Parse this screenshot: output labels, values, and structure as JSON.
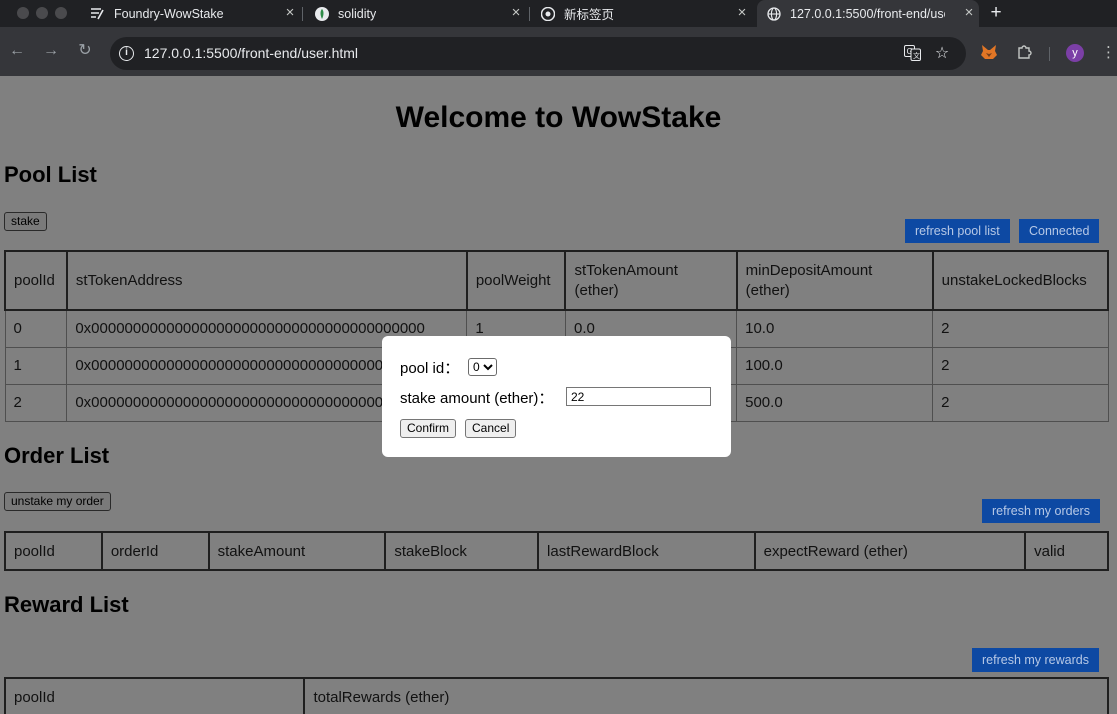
{
  "browser": {
    "tabs": [
      {
        "title": "Foundry-WowStake",
        "icon": "foundry-icon",
        "active": false
      },
      {
        "title": "solidity",
        "icon": "leaf-icon",
        "active": false
      },
      {
        "title": "新标签页",
        "icon": "chrome-icon",
        "active": false
      },
      {
        "title": "127.0.0.1:5500/front-end/user.html",
        "icon": "globe-icon",
        "active": true
      }
    ],
    "url": "127.0.0.1:5500/front-end/user.html",
    "avatar_letter": "y"
  },
  "page": {
    "title": "Welcome to WowStake",
    "pool_section": {
      "heading": "Pool List",
      "stake_button": "stake",
      "refresh_button": "refresh pool list",
      "connect_button": "Connected",
      "headers": [
        "poolId",
        "stTokenAddress",
        "poolWeight",
        "stTokenAmount\n(ether)",
        "minDepositAmount\n(ether)",
        "unstakeLockedBlocks"
      ],
      "rows": [
        [
          "0",
          "0x0000000000000000000000000000000000000000",
          "1",
          "0.0",
          "10.0",
          "2"
        ],
        [
          "1",
          "0x0000000000000000000000000000000000000000",
          "",
          "",
          "100.0",
          "2"
        ],
        [
          "2",
          "0x0000000000000000000000000000000000000000",
          "",
          "",
          "500.0",
          "2"
        ]
      ]
    },
    "order_section": {
      "heading": "Order List",
      "unstake_button": "unstake my order",
      "refresh_button": "refresh my orders",
      "headers": [
        "poolId",
        "orderId",
        "stakeAmount",
        "stakeBlock",
        "lastRewardBlock",
        "expectReward (ether)",
        "valid"
      ]
    },
    "reward_section": {
      "heading": "Reward List",
      "refresh_button": "refresh my rewards",
      "headers": [
        "poolId",
        "totalRewards (ether)"
      ]
    }
  },
  "modal": {
    "pool_id_label": "pool id：",
    "pool_id_value": "0",
    "amount_label": "stake amount (ether)：",
    "amount_value": "22",
    "confirm_button": "Confirm",
    "cancel_button": "Cancel"
  },
  "colors": {
    "overlay": "#808080",
    "primary_button": "#0d49a3",
    "chrome_dark": "#202124"
  }
}
